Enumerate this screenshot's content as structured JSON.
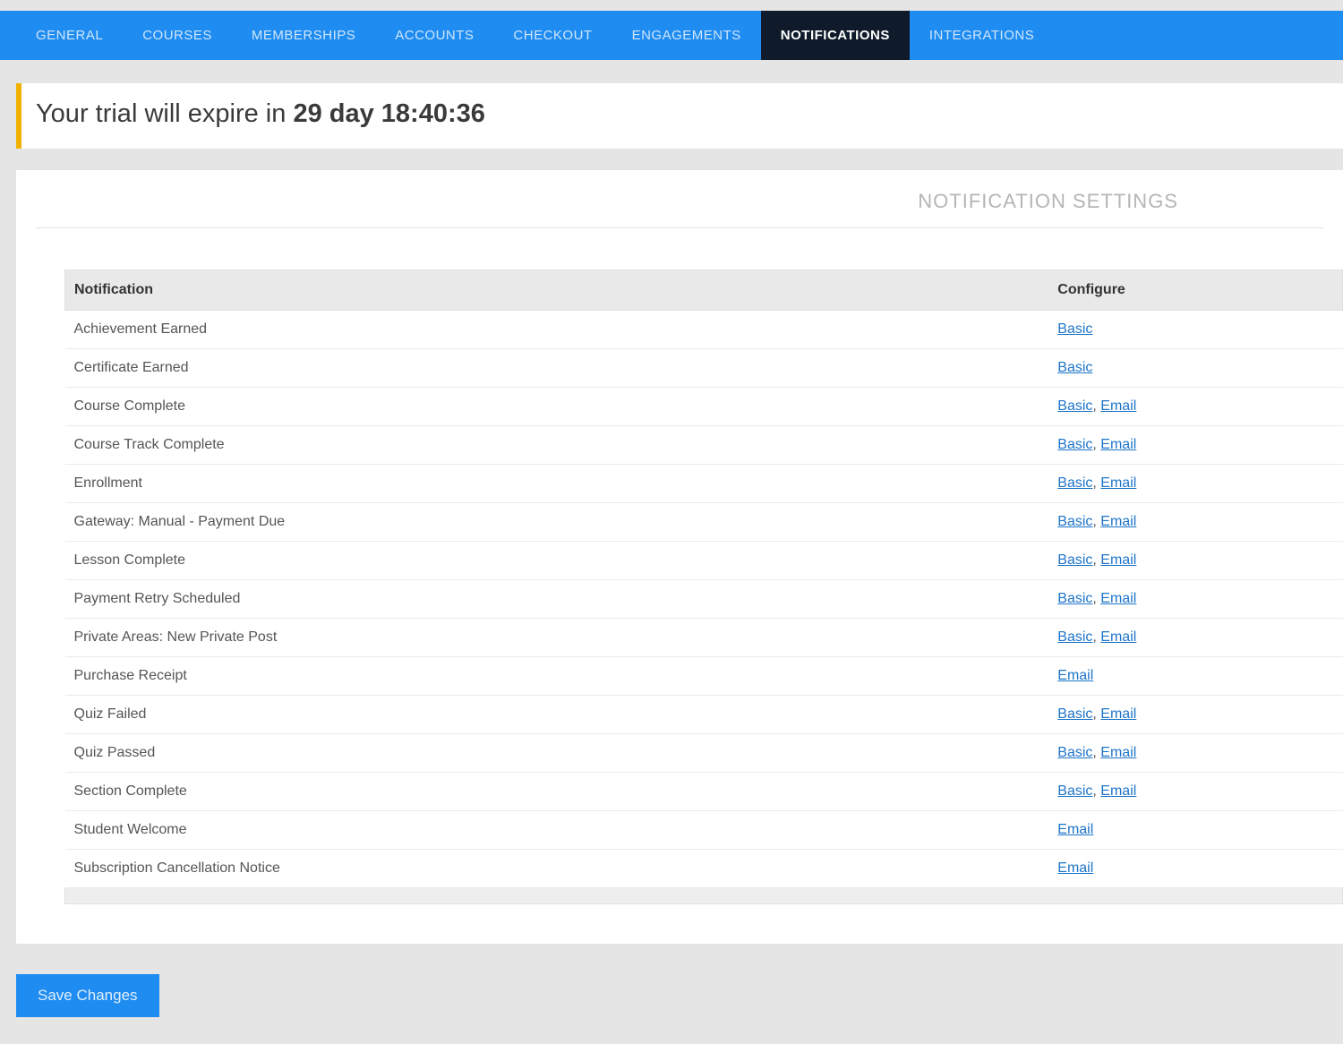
{
  "nav": {
    "items": [
      {
        "label": "GENERAL",
        "active": false
      },
      {
        "label": "COURSES",
        "active": false
      },
      {
        "label": "MEMBERSHIPS",
        "active": false
      },
      {
        "label": "ACCOUNTS",
        "active": false
      },
      {
        "label": "CHECKOUT",
        "active": false
      },
      {
        "label": "ENGAGEMENTS",
        "active": false
      },
      {
        "label": "NOTIFICATIONS",
        "active": true
      },
      {
        "label": "INTEGRATIONS",
        "active": false
      }
    ]
  },
  "trial": {
    "prefix": "Your trial will expire in ",
    "countdown": "29 day 18:40:36"
  },
  "panel": {
    "title": "NOTIFICATION SETTINGS"
  },
  "table": {
    "header_notification": "Notification",
    "header_configure": "Configure",
    "rows": [
      {
        "name": "Achievement Earned",
        "links": [
          "Basic"
        ]
      },
      {
        "name": "Certificate Earned",
        "links": [
          "Basic"
        ]
      },
      {
        "name": "Course Complete",
        "links": [
          "Basic",
          "Email"
        ]
      },
      {
        "name": "Course Track Complete",
        "links": [
          "Basic",
          "Email"
        ]
      },
      {
        "name": "Enrollment",
        "links": [
          "Basic",
          "Email"
        ]
      },
      {
        "name": "Gateway: Manual - Payment Due",
        "links": [
          "Basic",
          "Email"
        ]
      },
      {
        "name": "Lesson Complete",
        "links": [
          "Basic",
          "Email"
        ]
      },
      {
        "name": "Payment Retry Scheduled",
        "links": [
          "Basic",
          "Email"
        ]
      },
      {
        "name": "Private Areas: New Private Post",
        "links": [
          "Basic",
          "Email"
        ]
      },
      {
        "name": "Purchase Receipt",
        "links": [
          "Email"
        ]
      },
      {
        "name": "Quiz Failed",
        "links": [
          "Basic",
          "Email"
        ]
      },
      {
        "name": "Quiz Passed",
        "links": [
          "Basic",
          "Email"
        ]
      },
      {
        "name": "Section Complete",
        "links": [
          "Basic",
          "Email"
        ]
      },
      {
        "name": "Student Welcome",
        "links": [
          "Email"
        ]
      },
      {
        "name": "Subscription Cancellation Notice",
        "links": [
          "Email"
        ]
      }
    ]
  },
  "buttons": {
    "save": "Save Changes"
  }
}
